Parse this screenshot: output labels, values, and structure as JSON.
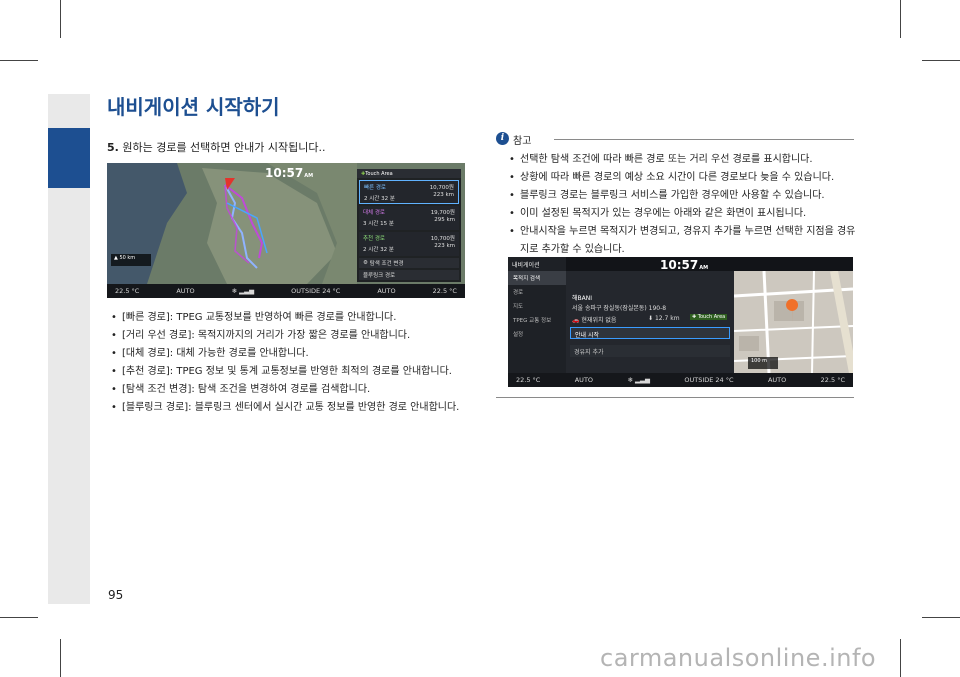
{
  "header": {
    "title": "내비게이션 시작하기"
  },
  "step": {
    "number": "5.",
    "text": "원하는 경로를 선택하면 안내가 시작됩니다.."
  },
  "screen1": {
    "clock": "10:57",
    "clock_ampm": "AM",
    "touch_area": "Touch Area",
    "routes": [
      {
        "name": "빠른 경로",
        "time": "2 시간 32 분",
        "cost": "10,700원",
        "distance": "223 km"
      },
      {
        "name": "대체 경로",
        "time": "3 시간 15 분",
        "cost": "19,700원",
        "distance": "295 km"
      },
      {
        "name": "추천 경로",
        "time": "2 시간 32 분",
        "cost": "10,700원",
        "distance": "223 km"
      }
    ],
    "btn_condition": "탐색 조건 변경",
    "btn_bluelink": "블루링크 경로",
    "scale": "50 km",
    "status": {
      "temp_left": "22.5 °C",
      "auto_left": "AUTO",
      "outside": "OUTSIDE  24 °C",
      "auto_right": "AUTO",
      "temp_right": "22.5 °C"
    }
  },
  "left_bullets": [
    "[빠른 경로]: TPEG 교통정보를 반영하여 빠른 경로를 안내합니다.",
    "[거리 우선 경로]: 목적지까지의 거리가 가장 짧은 경로를 안내합니다.",
    "[대체 경로]: 대체 가능한 경로를 안내합니다.",
    "[추천 경로]: TPEG 정보 및 통계 교통정보를 반영한 최적의 경로를 안내합니다.",
    "[탐색 조건 변경]: 탐색 조건을 변경하여 경로를 검색합니다.",
    "[블루링크 경로]: 블루링크 센터에서 실시간 교통 정보를 반영한 경로 안내합니다."
  ],
  "note": {
    "icon": "i",
    "label": "참고",
    "bullets": [
      "선택한 탐색 조건에 따라 빠른 경로 또는 거리 우선 경로를 표시합니다.",
      "상황에 따라 빠른 경로의 예상 소요 시간이 다른 경로보다 늦을 수 있습니다.",
      "블루링크 경로는 블루링크 서비스를 가입한 경우에만 사용할 수 있습니다.",
      "이미 설정된 목적지가 있는 경우에는 아래와 같은 화면이 표시됩니다.",
      "안내시작을 누르면 목적지가 변경되고, 경유지 추가를 누르면 선택한 지점을 경유지로 추가할 수 있습니다."
    ]
  },
  "screen2": {
    "menu_title": "내비게이션",
    "clock": "10:57",
    "clock_ampm": "AM",
    "menu": [
      "목적지 검색",
      "경로",
      "지도",
      "TPEG 교통 정보",
      "설정"
    ],
    "dest_name": "해BANI",
    "dest_addr": "서울 송파구 잠실동(잠실본동) 190-8",
    "current_label": "현재위치 없음",
    "distance": "12.7 km",
    "touch_area": "Touch Area",
    "btn_start": "안내 시작",
    "btn_waypoint": "경유지 추가",
    "scale": "100 m",
    "status": {
      "temp_left": "22.5 °C",
      "auto_left": "AUTO",
      "outside": "OUTSIDE  24 °C",
      "auto_right": "AUTO",
      "temp_right": "22.5 °C"
    }
  },
  "page_number": "95",
  "watermark": "carmanualsonline.info",
  "colors": {
    "accent": "#1d4f91",
    "sidebar": "#e9e9e9",
    "screen_bg": "#1a1d22",
    "route_selected": "#60b2ff",
    "route_line": "#c04ad8"
  }
}
